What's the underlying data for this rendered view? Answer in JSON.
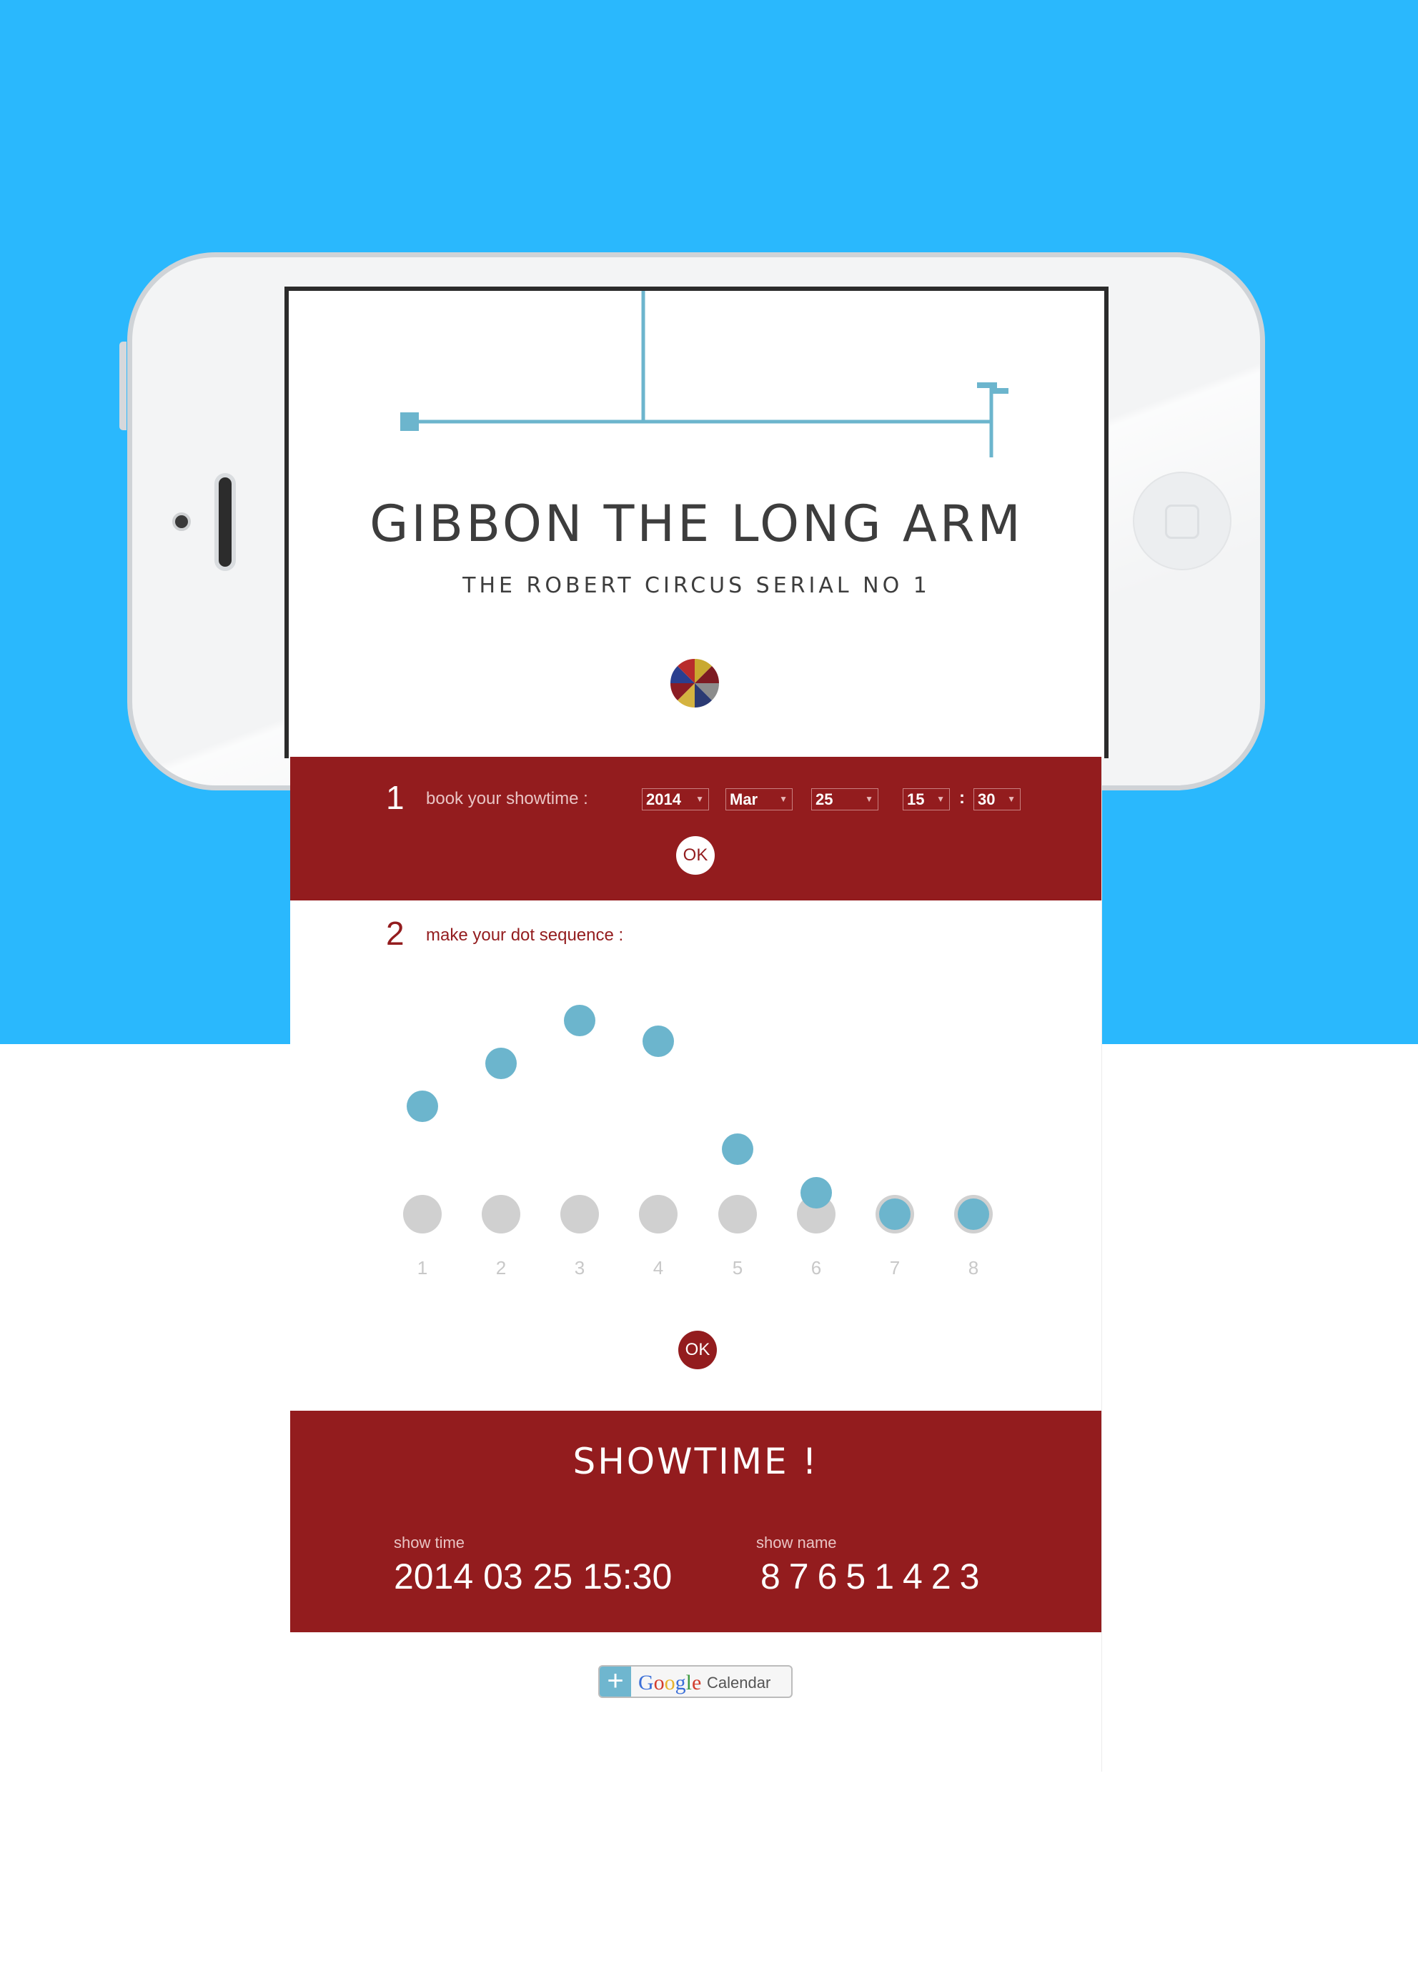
{
  "screen": {
    "title": "GIBBON THE LONG ARM",
    "subtitle": "THE ROBERT CIRCUS SERIAL NO 1"
  },
  "step1": {
    "number": "1",
    "label": "book your showtime :",
    "year": "2014",
    "month": "Mar",
    "day": "25",
    "hour": "15",
    "colon": ":",
    "minute": "30",
    "ok": "OK"
  },
  "step2": {
    "number": "2",
    "label": "make your dot sequence :",
    "dot_labels": [
      "1",
      "2",
      "3",
      "4",
      "5",
      "6",
      "7",
      "8"
    ],
    "ok": "OK"
  },
  "result": {
    "title": "SHOWTIME !",
    "show_time_label": "show time",
    "show_time_value": "2014 03 25 15:30",
    "show_name_label": "show name",
    "show_name_value": "87651423"
  },
  "google_calendar": {
    "plus": "+",
    "google": "Google",
    "calendar": "Calendar"
  },
  "colors": {
    "background_blue": "#2ab8fd",
    "brand_red": "#931c1e",
    "dot_blue": "#6cb5cd",
    "dot_grey": "#d0d0d0"
  }
}
